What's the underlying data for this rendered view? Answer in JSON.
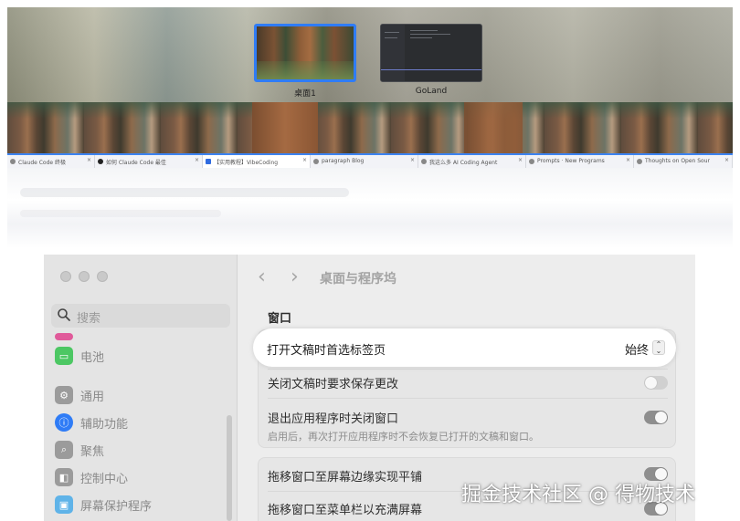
{
  "mission_control": {
    "spaces": [
      {
        "label": "桌面1"
      },
      {
        "label": "GoLand"
      }
    ],
    "browser_tabs": [
      {
        "title": "Claude Code 终极"
      },
      {
        "title": "如何 Claude Code 最佳"
      },
      {
        "title": "【实用教程】VibeCoding"
      },
      {
        "title": "paragraph Blog"
      },
      {
        "title": "我这么多 AI Coding Agent"
      },
      {
        "title": "Prompts · New Programs"
      },
      {
        "title": "Thoughts on Open Sour"
      }
    ]
  },
  "settings": {
    "title": "桌面与程序坞",
    "search_placeholder": "搜索",
    "sidebar": [
      {
        "label": "电池",
        "icon": "battery-icon",
        "color": "#4cc763"
      },
      {
        "label": "通用",
        "icon": "gear-icon",
        "color": "#9b9b9b"
      },
      {
        "label": "辅助功能",
        "icon": "accessibility-icon",
        "color": "#2f7cf6"
      },
      {
        "label": "聚焦",
        "icon": "magnifier-icon",
        "color": "#9b9b9b"
      },
      {
        "label": "控制中心",
        "icon": "control-center-icon",
        "color": "#9b9b9b"
      },
      {
        "label": "屏幕保护程序",
        "icon": "screensaver-icon",
        "color": "#5fb3e8"
      }
    ],
    "section_title": "窗口",
    "rows": {
      "prefer_tabs": {
        "label": "打开文稿时首选标签页",
        "value": "始终"
      },
      "ask_save": {
        "label": "关闭文稿时要求保存更改",
        "on": false
      },
      "close_windows": {
        "label": "退出应用程序时关闭窗口",
        "sub": "启用后，再次打开应用程序时不会恢复已打开的文稿和窗口。",
        "on": true
      },
      "drag_edge": {
        "label": "拖移窗口至屏幕边缘实现平铺",
        "on": true
      },
      "drag_menubar": {
        "label": "拖移窗口至菜单栏以充满屏幕",
        "on": true
      }
    }
  },
  "watermark": "掘金技术社区 @ 得物技术"
}
